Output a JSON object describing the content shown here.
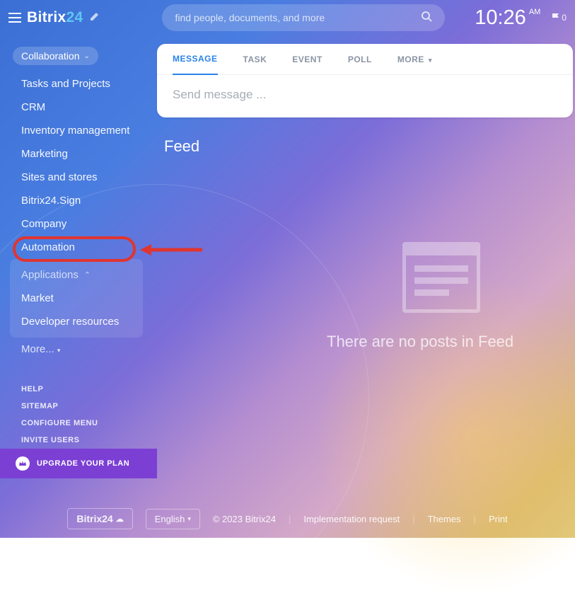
{
  "header": {
    "logo_part1": "Bitrix",
    "logo_part2": "24",
    "search_placeholder": "find people, documents, and more",
    "time": "10:26",
    "ampm": "AM",
    "flag_count": "0"
  },
  "sidebar": {
    "pill": "Collaboration",
    "items": [
      "Tasks and Projects",
      "CRM",
      "Inventory management",
      "Marketing",
      "Sites and stores",
      "Bitrix24.Sign",
      "Company",
      "Automation"
    ],
    "apps_label": "Applications",
    "sub_items": [
      "Market",
      "Developer resources"
    ],
    "more": "More...",
    "footer": [
      "HELP",
      "SITEMAP",
      "CONFIGURE MENU",
      "INVITE USERS"
    ],
    "upgrade": "UPGRADE YOUR PLAN"
  },
  "compose": {
    "tabs": [
      "MESSAGE",
      "TASK",
      "EVENT",
      "POLL",
      "MORE"
    ],
    "placeholder": "Send message ..."
  },
  "feed": {
    "title": "Feed",
    "empty": "There are no posts in Feed"
  },
  "bottombar": {
    "logo": "Bitrix24",
    "lang": "English",
    "copyright": "© 2023 Bitrix24",
    "links": [
      "Implementation request",
      "Themes",
      "Print"
    ]
  }
}
